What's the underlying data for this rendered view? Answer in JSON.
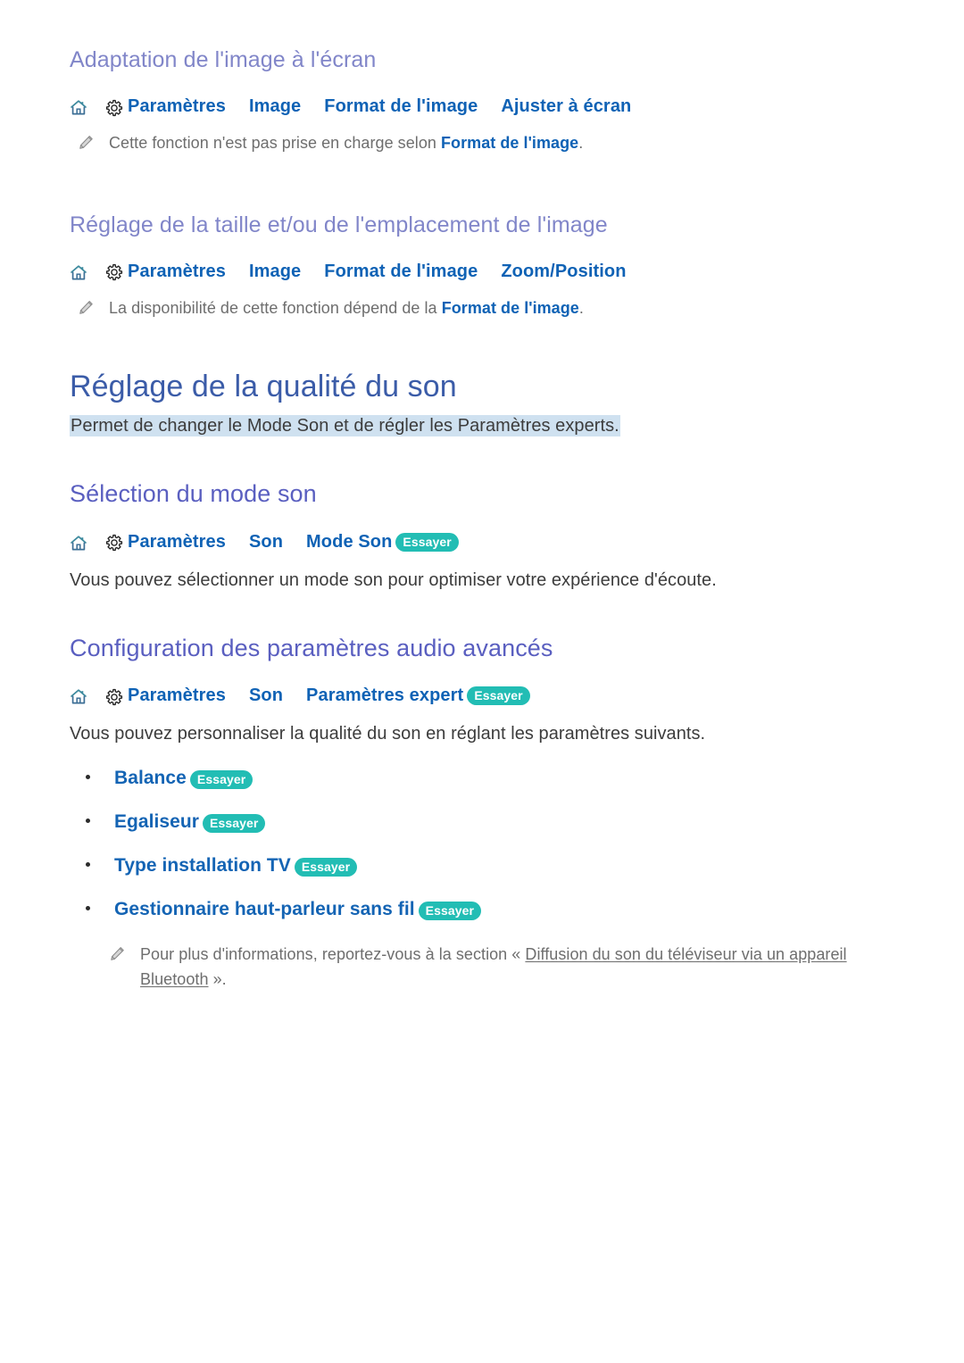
{
  "sections": [
    {
      "heading": "Adaptation de l'image à l'écran",
      "path": [
        "Paramètres",
        "Image",
        "Format de l'image",
        "Ajuster à écran"
      ],
      "note_prefix": "Cette fonction n'est pas prise en charge selon ",
      "note_bold": "Format de l'image",
      "note_suffix": "."
    },
    {
      "heading": "Réglage de la taille et/ou de l'emplacement de l'image",
      "path": [
        "Paramètres",
        "Image",
        "Format de l'image",
        "Zoom/Position"
      ],
      "note_prefix": "La disponibilité de cette fonction dépend de la ",
      "note_bold": "Format de l'image",
      "note_suffix": "."
    }
  ],
  "main": {
    "title": "Réglage de la qualité du son",
    "subtitle": "Permet de changer le Mode Son et de régler les Paramètres experts."
  },
  "sound_mode": {
    "heading": "Sélection du mode son",
    "path": [
      "Paramètres",
      "Son",
      "Mode Son"
    ],
    "badge": "Essayer",
    "description": "Vous pouvez sélectionner un mode son pour optimiser votre expérience d'écoute."
  },
  "advanced": {
    "heading": "Configuration des paramètres audio avancés",
    "path": [
      "Paramètres",
      "Son",
      "Paramètres expert"
    ],
    "badge": "Essayer",
    "description": "Vous pouvez personnaliser la qualité du son en réglant les paramètres suivants.",
    "items": [
      {
        "label": "Balance",
        "badge": "Essayer"
      },
      {
        "label": "Egaliseur",
        "badge": "Essayer"
      },
      {
        "label": "Type installation TV",
        "badge": "Essayer"
      },
      {
        "label": "Gestionnaire haut-parleur sans fil",
        "badge": "Essayer"
      }
    ],
    "footnote_prefix": "Pour plus d'informations, reportez-vous à la section « ",
    "footnote_link": "Diffusion du son du téléviseur via un appareil Bluetooth",
    "footnote_suffix": " »."
  },
  "icons": {
    "home": "home-icon",
    "gear": "gear-icon",
    "pencil": "pencil-icon"
  },
  "colors": {
    "h1": "#3b5ca8",
    "h2": "#5a5fc0",
    "h3": "#8186c9",
    "link": "#0f62b5",
    "badge_bg": "#22bdb4",
    "highlight_bg": "#cfe1f0",
    "note_text": "#6e6e6e",
    "body_text": "#3c3c3c"
  }
}
